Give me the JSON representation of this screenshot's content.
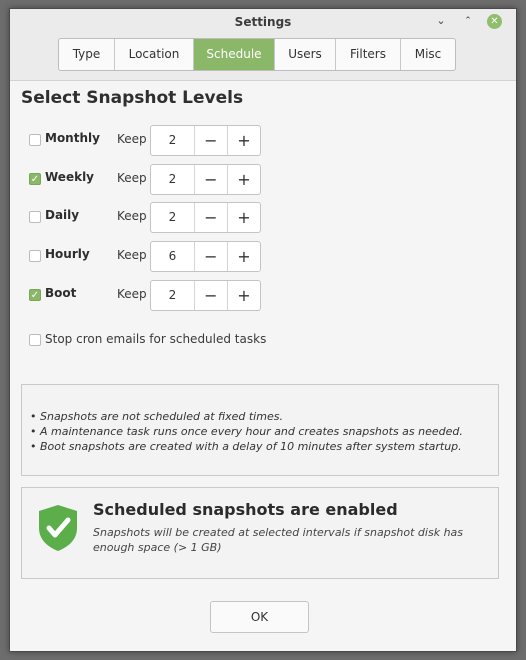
{
  "window": {
    "title": "Settings"
  },
  "tabs": [
    {
      "label": "Type",
      "active": false
    },
    {
      "label": "Location",
      "active": false
    },
    {
      "label": "Schedule",
      "active": true
    },
    {
      "label": "Users",
      "active": false
    },
    {
      "label": "Filters",
      "active": false
    },
    {
      "label": "Misc",
      "active": false
    }
  ],
  "section_heading": "Select Snapshot Levels",
  "keep_label": "Keep",
  "levels": [
    {
      "name": "Monthly",
      "checked": false,
      "keep": "2"
    },
    {
      "name": "Weekly",
      "checked": true,
      "keep": "2"
    },
    {
      "name": "Daily",
      "checked": false,
      "keep": "2"
    },
    {
      "name": "Hourly",
      "checked": false,
      "keep": "6"
    },
    {
      "name": "Boot",
      "checked": true,
      "keep": "2"
    }
  ],
  "spin_minus": "−",
  "spin_plus": "+",
  "cron_option": {
    "label": "Stop cron emails for scheduled tasks",
    "checked": false
  },
  "notes": [
    "• Snapshots are not scheduled at fixed times.",
    "• A maintenance task runs once every hour and creates snapshots as needed.",
    "• Boot snapshots are created with a delay of 10 minutes after system startup."
  ],
  "status": {
    "title": "Scheduled snapshots are enabled",
    "description": "Snapshots will be created at selected intervals if snapshot disk has enough space (> 1 GB)",
    "icon": "shield-check-icon"
  },
  "ok_label": "OK",
  "colors": {
    "accent": "#8ab768",
    "shield": "#5cae4a"
  }
}
